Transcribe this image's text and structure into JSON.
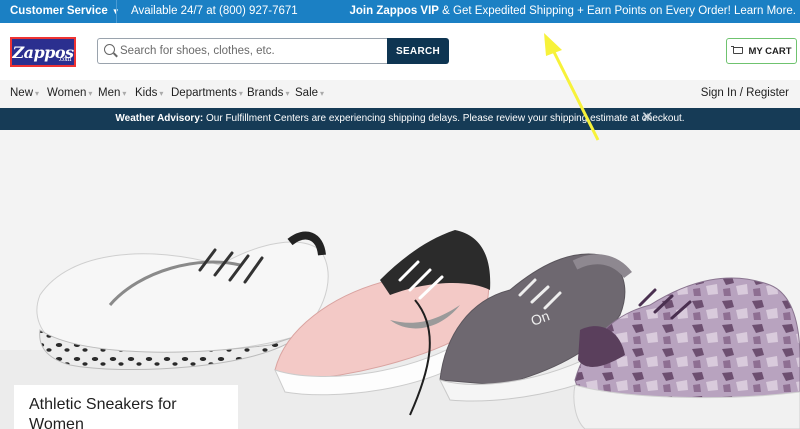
{
  "topbar": {
    "customer_service": "Customer Service",
    "availability": "Available 24/7 at (800) 927-7671",
    "promo_bold": "Join Zappos VIP",
    "promo_rest": " & Get Expedited Shipping + Earn Points on Every Order! Learn More."
  },
  "header": {
    "logo_text": "Zappos",
    "logo_suffix": ".com",
    "search_placeholder": "Search for shoes, clothes, etc.",
    "search_button": "SEARCH",
    "cart_label": "MY CART"
  },
  "nav": {
    "items": [
      "New",
      "Women",
      "Men",
      "Kids",
      "Departments",
      "Brands",
      "Sale"
    ],
    "signin": "Sign In / Register"
  },
  "advisory": {
    "label": "Weather Advisory:",
    "message": " Our Fulfillment Centers are experiencing shipping delays. Please review your shipping estimate at checkout.",
    "close_icon": "close-icon"
  },
  "hero": {
    "title": "Athletic Sneakers for Women",
    "image": "athletic-sneakers-photo"
  },
  "colors": {
    "topbar": "#1b80c4",
    "advisory": "#163b56",
    "search_button": "#0e3552",
    "cart_border": "#6fc36f",
    "annotation_arrow": "#f7f23a"
  }
}
